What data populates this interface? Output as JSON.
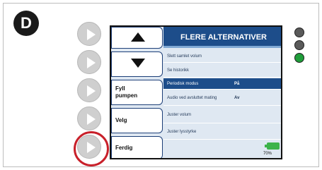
{
  "step_badge": "D",
  "screen": {
    "title": "FLERE ALTERNATIVER",
    "buttons": {
      "fill_pump": "Fyll\npumpen",
      "select": "Velg",
      "done": "Ferdig"
    },
    "menu": [
      {
        "label": "Slett samlet volum",
        "value": ""
      },
      {
        "label": "Se historikk",
        "value": ""
      },
      {
        "label": "Periodisk modus",
        "value": "På"
      },
      {
        "label": "Audio ved avsluttet mating",
        "value": "Av"
      },
      {
        "label": "Juster volum",
        "value": ""
      },
      {
        "label": "Juster lysstyrke",
        "value": ""
      }
    ],
    "selected_index": 2,
    "battery_percent": "70%"
  },
  "status_lights": [
    "#5a5a5a",
    "#5a5a5a",
    "#1f9d3a"
  ],
  "colors": {
    "title_blue": "#1d4d8a",
    "highlight_ring": "#c8202a",
    "battery_green": "#3cb34a"
  }
}
